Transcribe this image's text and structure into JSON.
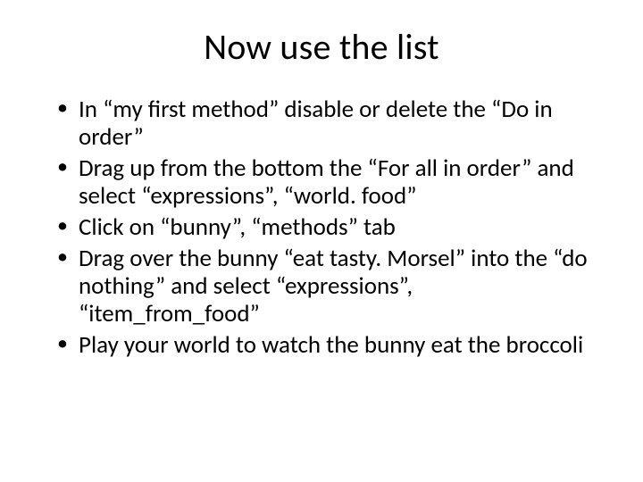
{
  "slide": {
    "title": "Now use the list",
    "bullets": [
      "In “my first method” disable or delete the “Do in order”",
      "Drag up from the bottom the “For all in order” and select “expressions”, “world. food”",
      "Click on “bunny”, “methods” tab",
      "Drag over the bunny “eat tasty. Morsel” into the “do nothing” and select “expressions”, “item_from_food”",
      "Play your world to watch the bunny eat the broccoli"
    ]
  }
}
